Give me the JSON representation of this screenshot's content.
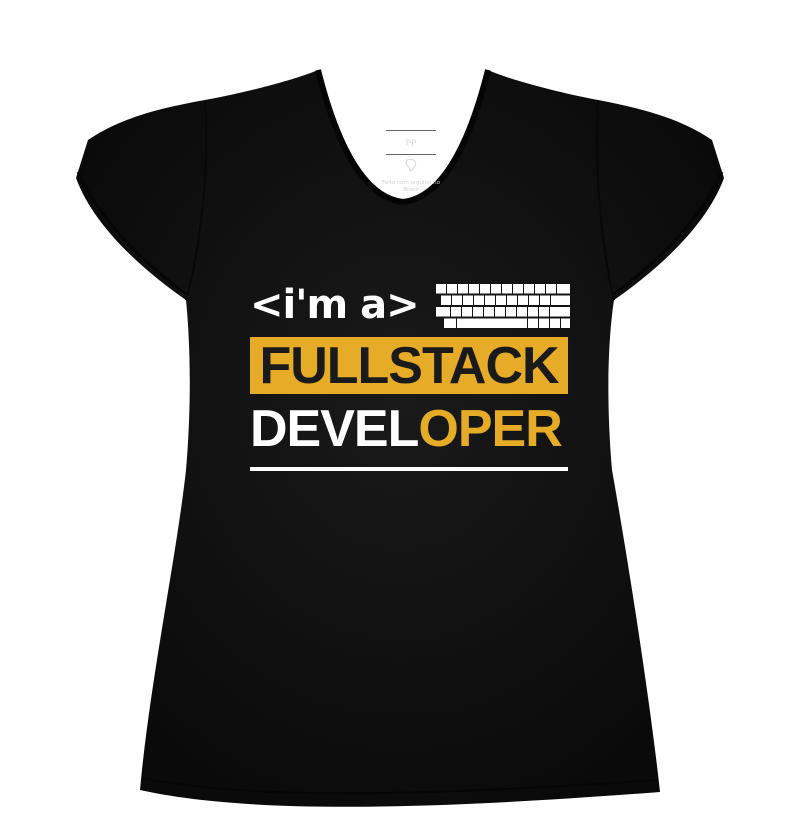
{
  "label": {
    "size": "PP",
    "made_in": "Feito com orgulho no Brasil"
  },
  "print": {
    "line1": "<i'm a>",
    "banner": "FULLSTACK",
    "word_white": "DEVEL",
    "word_yellow": "OPER"
  },
  "colors": {
    "shirt": "#121212",
    "accent": "#e6ac27",
    "text_dark": "#1a1a1a",
    "text_light": "#ffffff",
    "background": "#ffffff"
  },
  "icons": [
    "brazil-map-icon",
    "keyboard-icon"
  ]
}
